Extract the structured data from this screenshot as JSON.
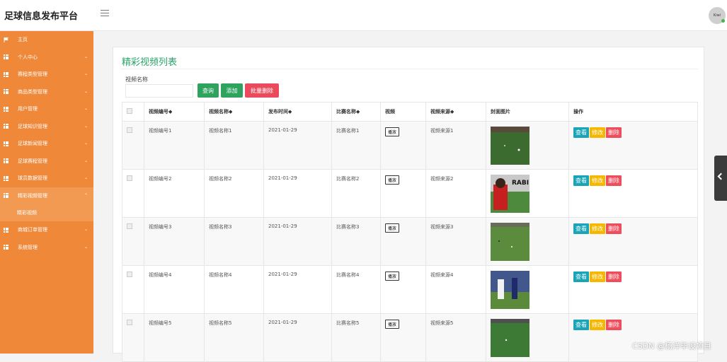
{
  "header": {
    "brand": "足球信息发布平台",
    "avatar_text": "Kiwi"
  },
  "sidebar": {
    "items": [
      {
        "label": "主页",
        "icon": "flag-icon"
      },
      {
        "label": "个人中心",
        "icon": "grid-icon"
      },
      {
        "label": "赛程类型管理",
        "icon": "grid-icon"
      },
      {
        "label": "商品类型管理",
        "icon": "grid-icon"
      },
      {
        "label": "用户管理",
        "icon": "grid-icon"
      },
      {
        "label": "足球知识管理",
        "icon": "grid-icon"
      },
      {
        "label": "足球新闻管理",
        "icon": "grid-icon"
      },
      {
        "label": "足球赛程管理",
        "icon": "grid-icon"
      },
      {
        "label": "球员数据管理",
        "icon": "grid-icon"
      },
      {
        "label": "精彩视频管理",
        "icon": "grid-icon"
      },
      {
        "label": "商城订单管理",
        "icon": "grid-icon"
      },
      {
        "label": "系统管理",
        "icon": "grid-icon"
      }
    ],
    "sub_item": "精彩视频"
  },
  "panel": {
    "title": "精彩视频列表",
    "search_label": "视频名称",
    "search_value": "",
    "buttons": {
      "search": "查询",
      "add": "添加",
      "batch_delete": "批量删除"
    }
  },
  "table": {
    "headers": [
      "视频编号",
      "视频名称",
      "发布时间",
      "比赛名称",
      "视频",
      "视频来源",
      "封面图片",
      "操作"
    ],
    "sort_mark": "◆",
    "play_label": "播放",
    "actions": {
      "view": "查看",
      "edit": "修改",
      "delete": "删除"
    },
    "rows": [
      {
        "code": "视频编号1",
        "name": "视频名称1",
        "date": "2021-01-29",
        "match": "比赛名称1",
        "source": "视频来源1"
      },
      {
        "code": "视频编号2",
        "name": "视频名称2",
        "date": "2021-01-29",
        "match": "比赛名称2",
        "source": "视频来源2"
      },
      {
        "code": "视频编号3",
        "name": "视频名称3",
        "date": "2021-01-29",
        "match": "比赛名称3",
        "source": "视频来源3"
      },
      {
        "code": "视频编号4",
        "name": "视频名称4",
        "date": "2021-01-29",
        "match": "比赛名称4",
        "source": "视频来源4"
      },
      {
        "code": "视频编号5",
        "name": "视频名称5",
        "date": "2021-01-29",
        "match": "比赛名称5",
        "source": "视频来源5"
      }
    ],
    "thumb_caption": "RABI"
  },
  "watermark": "CSDN @杨洋毕设项目",
  "colors": {
    "sidebar": "#f0883a",
    "accent": "#2aa56a",
    "view": "#1aa4b8",
    "edit": "#f5b700",
    "delete": "#ef4c5c"
  }
}
